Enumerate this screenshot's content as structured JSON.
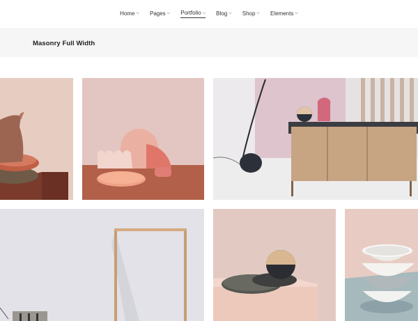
{
  "nav": {
    "items": [
      {
        "label": "Home",
        "active": false
      },
      {
        "label": "Pages",
        "active": false
      },
      {
        "label": "Portfolio",
        "active": true
      },
      {
        "label": "Blog",
        "active": false
      },
      {
        "label": "Shop",
        "active": false
      },
      {
        "label": "Elements",
        "active": false
      }
    ],
    "chevron_icon": "chevron-down-icon"
  },
  "header": {
    "title": "Masonry Full Width"
  },
  "colors": {
    "titlebar_bg": "#f6f6f6",
    "text": "#222222"
  },
  "portfolio": {
    "items": [
      {
        "name": "pitcher-and-bowls"
      },
      {
        "name": "pink-shapes-composition"
      },
      {
        "name": "floor-lamp-and-sideboard"
      },
      {
        "name": "wooden-frame-stand"
      },
      {
        "name": "sphere-on-plinth"
      },
      {
        "name": "stacked-bowls"
      }
    ]
  }
}
